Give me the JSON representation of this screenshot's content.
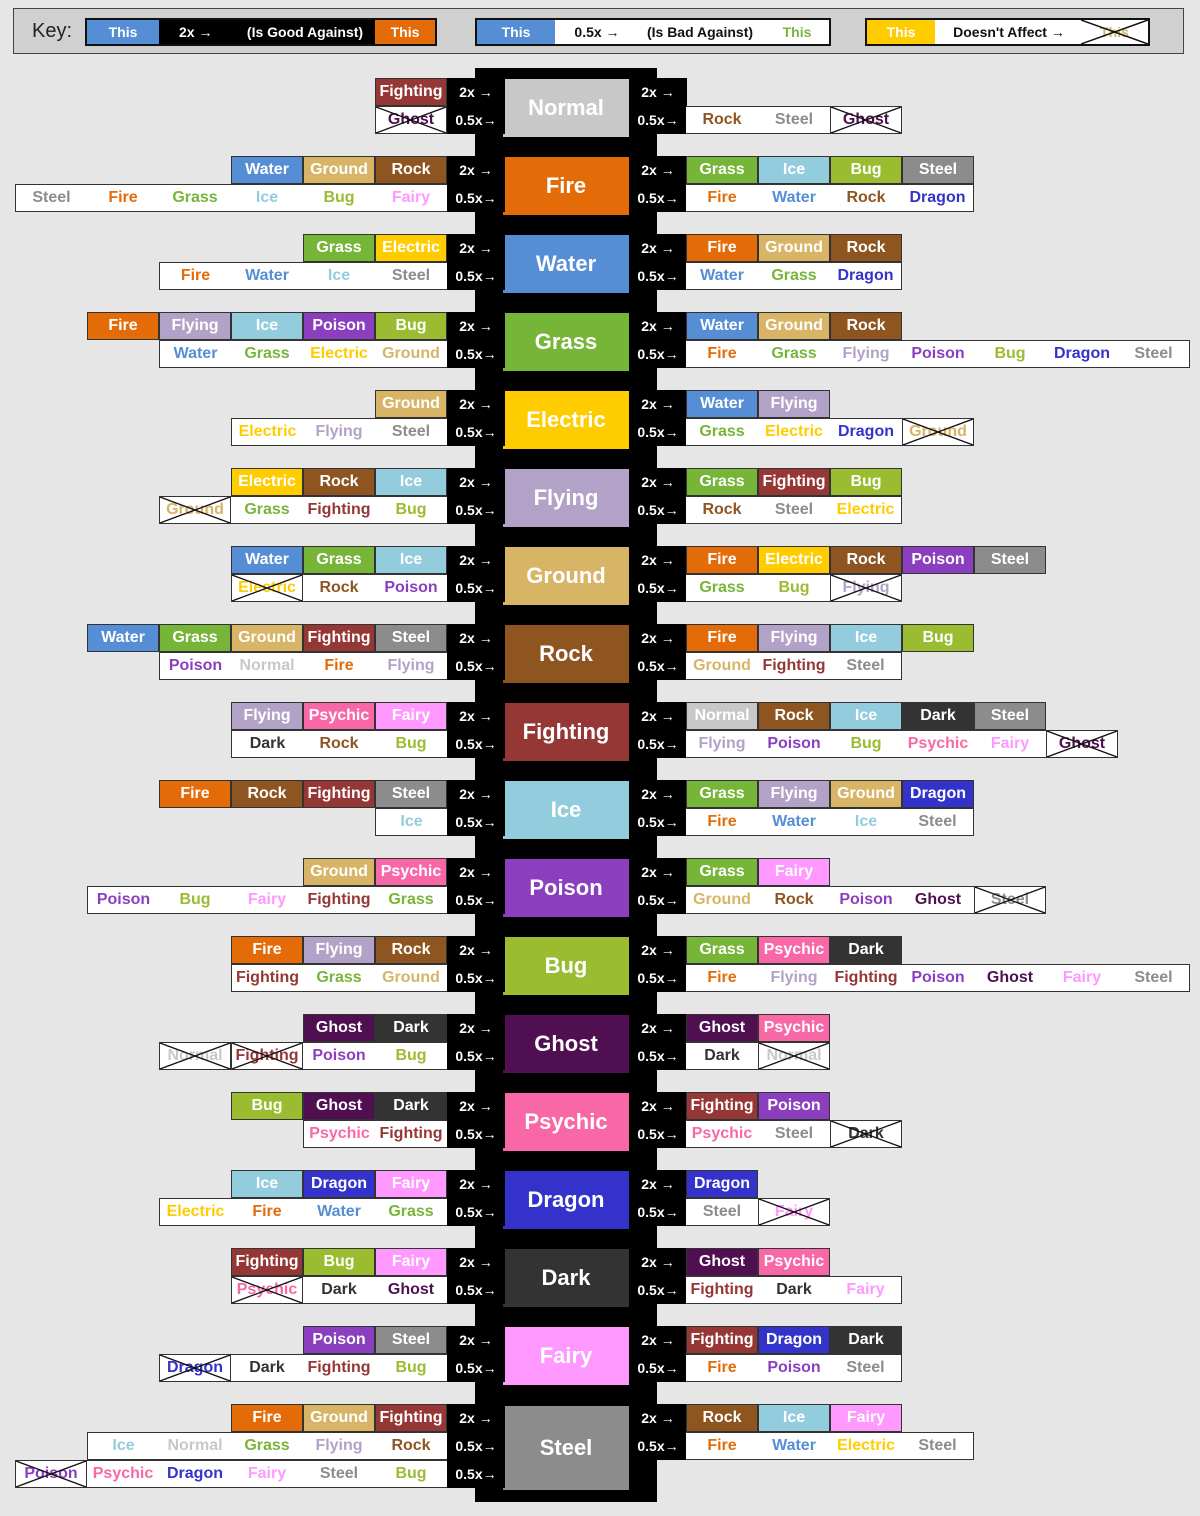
{
  "key": {
    "title": "Key:",
    "good": {
      "this_left": "This",
      "mult": "2x →",
      "text": "(Is Good Against)",
      "this_right": "This"
    },
    "bad": {
      "this_left": "This",
      "mult": "0.5x →",
      "text": "(Is Bad Against)",
      "this_right": "This"
    },
    "none": {
      "this_left": "This",
      "text": "Doesn't Affect →",
      "this_right": "This"
    }
  },
  "colors": {
    "Normal": "#c8c8c8",
    "Fire": "#e36c09",
    "Water": "#558ed5",
    "Grass": "#77b539",
    "Electric": "#ffcc00",
    "Flying": "#b3a2c7",
    "Ground": "#d7b466",
    "Rock": "#8f5520",
    "Fighting": "#953735",
    "Ice": "#93cddd",
    "Poison": "#8b3fbf",
    "Bug": "#9bbb31",
    "Ghost": "#4f0f50",
    "Psychic": "#f868a6",
    "Dragon": "#3333cc",
    "Dark": "#333333",
    "Fairy": "#ff99ff",
    "Steel": "#8c8c8c"
  },
  "labels": {
    "double": "2x →",
    "half": "0.5x→",
    "half_right": "0.5x→"
  },
  "types": [
    {
      "name": "Normal",
      "atk2": [],
      "atkHalf": [
        "Rock",
        "Steel"
      ],
      "atkNone": [
        "Ghost"
      ],
      "def2": [
        "Fighting"
      ],
      "defHalf": [],
      "defNone": [
        "Ghost"
      ]
    },
    {
      "name": "Fire",
      "atk2": [
        "Grass",
        "Ice",
        "Bug",
        "Steel"
      ],
      "atkHalf": [
        "Fire",
        "Water",
        "Rock",
        "Dragon"
      ],
      "atkNone": [],
      "def2": [
        "Water",
        "Ground",
        "Rock"
      ],
      "defHalf": [
        "Steel",
        "Fire",
        "Grass",
        "Ice",
        "Bug",
        "Fairy"
      ],
      "defNone": []
    },
    {
      "name": "Water",
      "atk2": [
        "Fire",
        "Ground",
        "Rock"
      ],
      "atkHalf": [
        "Water",
        "Grass",
        "Dragon"
      ],
      "atkNone": [],
      "def2": [
        "Grass",
        "Electric"
      ],
      "defHalf": [
        "Fire",
        "Water",
        "Ice",
        "Steel"
      ],
      "defNone": []
    },
    {
      "name": "Grass",
      "atk2": [
        "Water",
        "Ground",
        "Rock"
      ],
      "atkHalf": [
        "Fire",
        "Grass",
        "Flying",
        "Poison",
        "Bug",
        "Dragon",
        "Steel"
      ],
      "atkNone": [],
      "def2": [
        "Fire",
        "Flying",
        "Ice",
        "Poison",
        "Bug"
      ],
      "defHalf": [
        "Water",
        "Grass",
        "Electric",
        "Ground"
      ],
      "defNone": []
    },
    {
      "name": "Electric",
      "atk2": [
        "Water",
        "Flying"
      ],
      "atkHalf": [
        "Grass",
        "Electric",
        "Dragon"
      ],
      "atkNone": [
        "Ground"
      ],
      "def2": [
        "Ground"
      ],
      "defHalf": [
        "Electric",
        "Flying",
        "Steel"
      ],
      "defNone": []
    },
    {
      "name": "Flying",
      "atk2": [
        "Grass",
        "Fighting",
        "Bug"
      ],
      "atkHalf": [
        "Rock",
        "Steel",
        "Electric"
      ],
      "atkNone": [],
      "def2": [
        "Electric",
        "Rock",
        "Ice"
      ],
      "defHalf": [
        "Grass",
        "Fighting",
        "Bug"
      ],
      "defNone": [
        "Ground"
      ]
    },
    {
      "name": "Ground",
      "atk2": [
        "Fire",
        "Electric",
        "Rock",
        "Poison",
        "Steel"
      ],
      "atkHalf": [
        "Grass",
        "Bug"
      ],
      "atkNone": [
        "Flying"
      ],
      "def2": [
        "Water",
        "Grass",
        "Ice"
      ],
      "defHalf": [
        "Rock",
        "Poison"
      ],
      "defNone": [
        "Electric"
      ]
    },
    {
      "name": "Rock",
      "atk2": [
        "Fire",
        "Flying",
        "Ice",
        "Bug"
      ],
      "atkHalf": [
        "Ground",
        "Fighting",
        "Steel"
      ],
      "atkNone": [],
      "def2": [
        "Water",
        "Grass",
        "Ground",
        "Fighting",
        "Steel"
      ],
      "defHalf": [
        "Poison",
        "Normal",
        "Fire",
        "Flying"
      ],
      "defNone": []
    },
    {
      "name": "Fighting",
      "atk2": [
        "Normal",
        "Rock",
        "Ice",
        "Dark",
        "Steel"
      ],
      "atkHalf": [
        "Flying",
        "Poison",
        "Bug",
        "Psychic",
        "Fairy"
      ],
      "atkNone": [
        "Ghost"
      ],
      "def2": [
        "Flying",
        "Psychic",
        "Fairy"
      ],
      "defHalf": [
        "Dark",
        "Rock",
        "Bug"
      ],
      "defNone": []
    },
    {
      "name": "Ice",
      "atk2": [
        "Grass",
        "Flying",
        "Ground",
        "Dragon"
      ],
      "atkHalf": [
        "Fire",
        "Water",
        "Ice",
        "Steel"
      ],
      "atkNone": [],
      "def2": [
        "Fire",
        "Rock",
        "Fighting",
        "Steel"
      ],
      "defHalf": [
        "Ice"
      ],
      "defNone": []
    },
    {
      "name": "Poison",
      "atk2": [
        "Grass",
        "Fairy"
      ],
      "atkHalf": [
        "Ground",
        "Rock",
        "Poison",
        "Ghost"
      ],
      "atkNone": [
        "Steel"
      ],
      "def2": [
        "Ground",
        "Psychic"
      ],
      "defHalf": [
        "Poison",
        "Bug",
        "Fairy",
        "Fighting",
        "Grass"
      ],
      "defNone": []
    },
    {
      "name": "Bug",
      "atk2": [
        "Grass",
        "Psychic",
        "Dark"
      ],
      "atkHalf": [
        "Fire",
        "Flying",
        "Fighting",
        "Poison",
        "Ghost",
        "Fairy",
        "Steel"
      ],
      "atkNone": [],
      "def2": [
        "Fire",
        "Flying",
        "Rock"
      ],
      "defHalf": [
        "Fighting",
        "Grass",
        "Ground"
      ],
      "defNone": []
    },
    {
      "name": "Ghost",
      "atk2": [
        "Ghost",
        "Psychic"
      ],
      "atkHalf": [
        "Dark"
      ],
      "atkNone": [
        "Normal"
      ],
      "def2": [
        "Ghost",
        "Dark"
      ],
      "defHalf": [
        "Poison",
        "Bug"
      ],
      "defNone": [
        "Normal",
        "Fighting"
      ]
    },
    {
      "name": "Psychic",
      "atk2": [
        "Fighting",
        "Poison"
      ],
      "atkHalf": [
        "Psychic",
        "Steel"
      ],
      "atkNone": [
        "Dark"
      ],
      "def2": [
        "Bug",
        "Ghost",
        "Dark"
      ],
      "defHalf": [
        "Psychic",
        "Fighting"
      ],
      "defNone": []
    },
    {
      "name": "Dragon",
      "atk2": [
        "Dragon"
      ],
      "atkHalf": [
        "Steel"
      ],
      "atkNone": [
        "Fairy"
      ],
      "def2": [
        "Ice",
        "Dragon",
        "Fairy"
      ],
      "defHalf": [
        "Electric",
        "Fire",
        "Water",
        "Grass"
      ],
      "defNone": []
    },
    {
      "name": "Dark",
      "atk2": [
        "Ghost",
        "Psychic"
      ],
      "atkHalf": [
        "Fighting",
        "Dark",
        "Fairy"
      ],
      "atkNone": [],
      "def2": [
        "Fighting",
        "Bug",
        "Fairy"
      ],
      "defHalf": [
        "Dark",
        "Ghost"
      ],
      "defNone": [
        "Psychic"
      ]
    },
    {
      "name": "Fairy",
      "atk2": [
        "Fighting",
        "Dragon",
        "Dark"
      ],
      "atkHalf": [
        "Fire",
        "Poison",
        "Steel"
      ],
      "atkNone": [],
      "def2": [
        "Poison",
        "Steel"
      ],
      "defHalf": [
        "Dark",
        "Fighting",
        "Bug"
      ],
      "defNone": [
        "Dragon"
      ]
    },
    {
      "name": "Steel",
      "atk2": [
        "Rock",
        "Ice",
        "Fairy"
      ],
      "atkHalf": [
        "Fire",
        "Water",
        "Electric",
        "Steel"
      ],
      "atkNone": [],
      "def2": [
        "Fire",
        "Ground",
        "Fighting"
      ],
      "defHalf": [
        "Ice",
        "Normal",
        "Grass",
        "Flying",
        "Rock",
        "Dragon",
        "Steel",
        "Psychic",
        "Bug",
        "Fairy"
      ],
      "defHalfRows": [
        [
          "Ice",
          "Normal",
          "Grass",
          "Flying",
          "Rock"
        ],
        [
          "Psychic",
          "Dragon",
          "Fairy",
          "Steel",
          "Bug"
        ]
      ],
      "defNone": [
        "Poison"
      ]
    }
  ]
}
